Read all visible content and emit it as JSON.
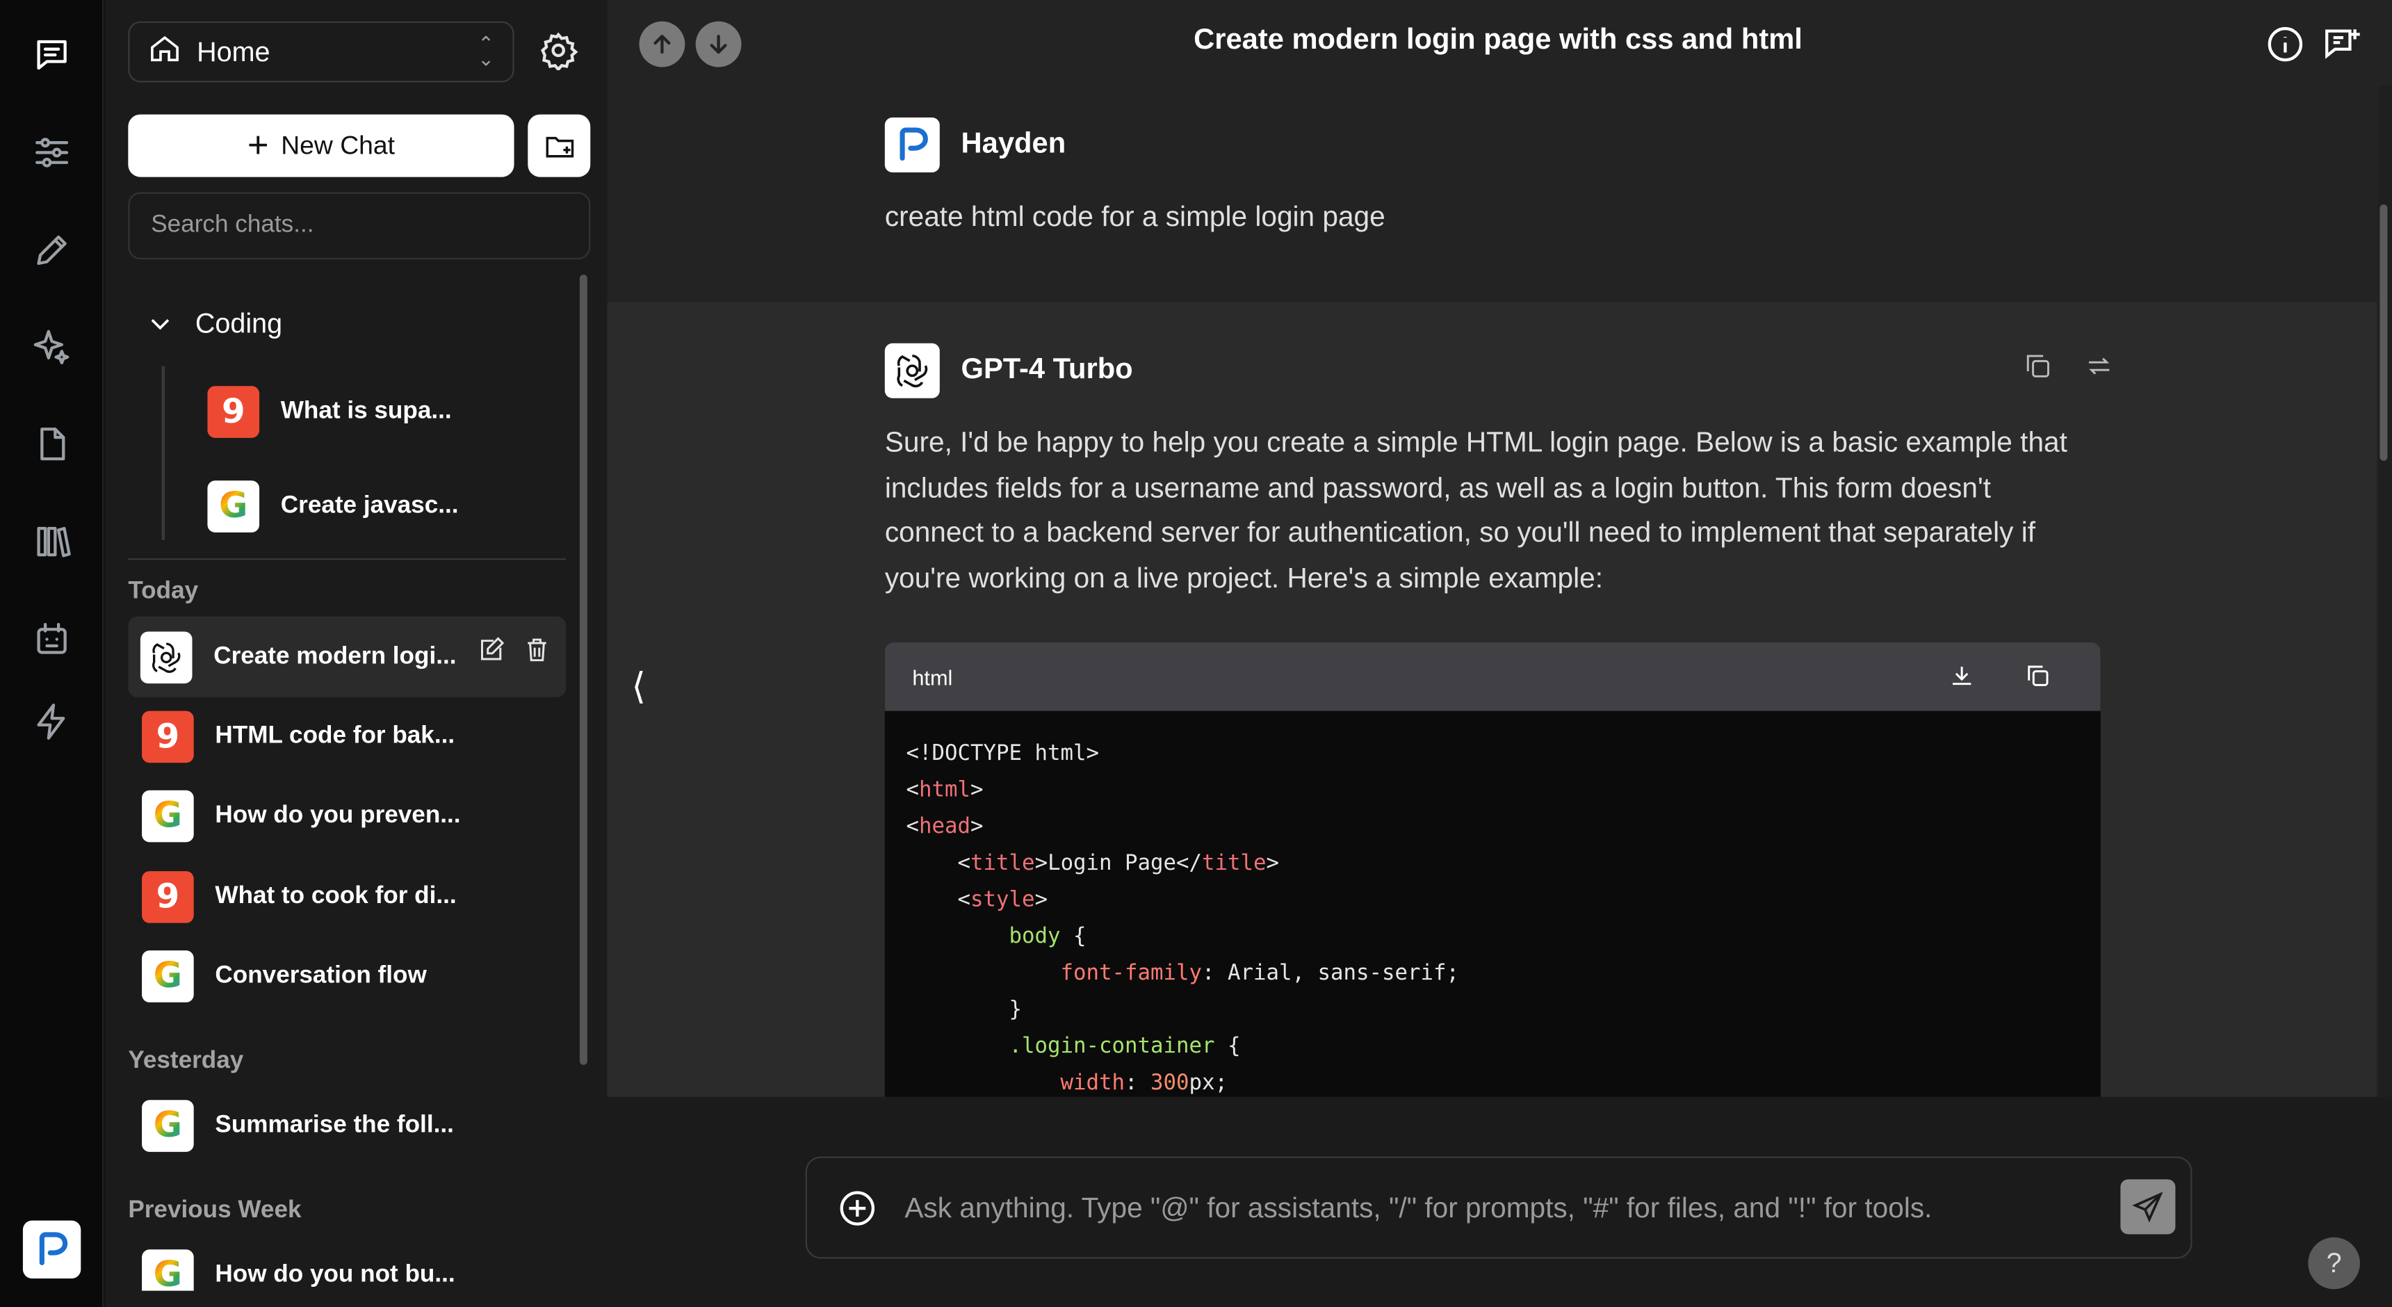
{
  "rail": {
    "items": [
      "chat-bubble-icon",
      "sliders-icon",
      "pencil-icon",
      "sparkles-icon",
      "file-icon",
      "library-icon",
      "bot-icon",
      "bolt-icon"
    ]
  },
  "sidebar": {
    "workspace": "Home",
    "new_chat_label": "New Chat",
    "search_placeholder": "Search chats...",
    "folder": {
      "name": "Coding",
      "items": [
        {
          "label": "What is supa...",
          "avatar": "red"
        },
        {
          "label": "Create javasc...",
          "avatar": "google"
        }
      ]
    },
    "sections": [
      {
        "label": "Today",
        "items": [
          {
            "label": "Create modern logi...",
            "avatar": "openai",
            "active": true
          },
          {
            "label": "HTML code for bak...",
            "avatar": "red"
          },
          {
            "label": "How do you preven...",
            "avatar": "google"
          },
          {
            "label": "What to cook for di...",
            "avatar": "red"
          },
          {
            "label": "Conversation flow",
            "avatar": "google"
          }
        ]
      },
      {
        "label": "Yesterday",
        "items": [
          {
            "label": "Summarise the foll...",
            "avatar": "google"
          }
        ]
      },
      {
        "label": "Previous Week",
        "items": [
          {
            "label": "How do you not bu...",
            "avatar": "google"
          }
        ]
      }
    ]
  },
  "header": {
    "title": "Create modern login page with css and html"
  },
  "messages": {
    "user": {
      "name": "Hayden",
      "text": "create html code for a simple login page"
    },
    "assistant": {
      "name": "GPT-4 Turbo",
      "text": "Sure, I'd be happy to help you create a simple HTML login page. Below is a basic example that includes fields for a username and password, as well as a login button. This form doesn't connect to a backend server for authentication, so you'll need to implement that separately if you're working on a live project. Here's a simple example:",
      "code_lang": "html"
    }
  },
  "composer": {
    "placeholder": "Ask anything. Type \"@\" for assistants, \"/\" for prompts, \"#\" for files, and \"!\" for tools."
  },
  "help_label": "?",
  "colors": {
    "accent_red": "#ee4a33",
    "code_tag": "#f07178",
    "code_selector": "#a6e36e",
    "code_property": "#ff7b72",
    "code_number": "#f78c6c"
  }
}
